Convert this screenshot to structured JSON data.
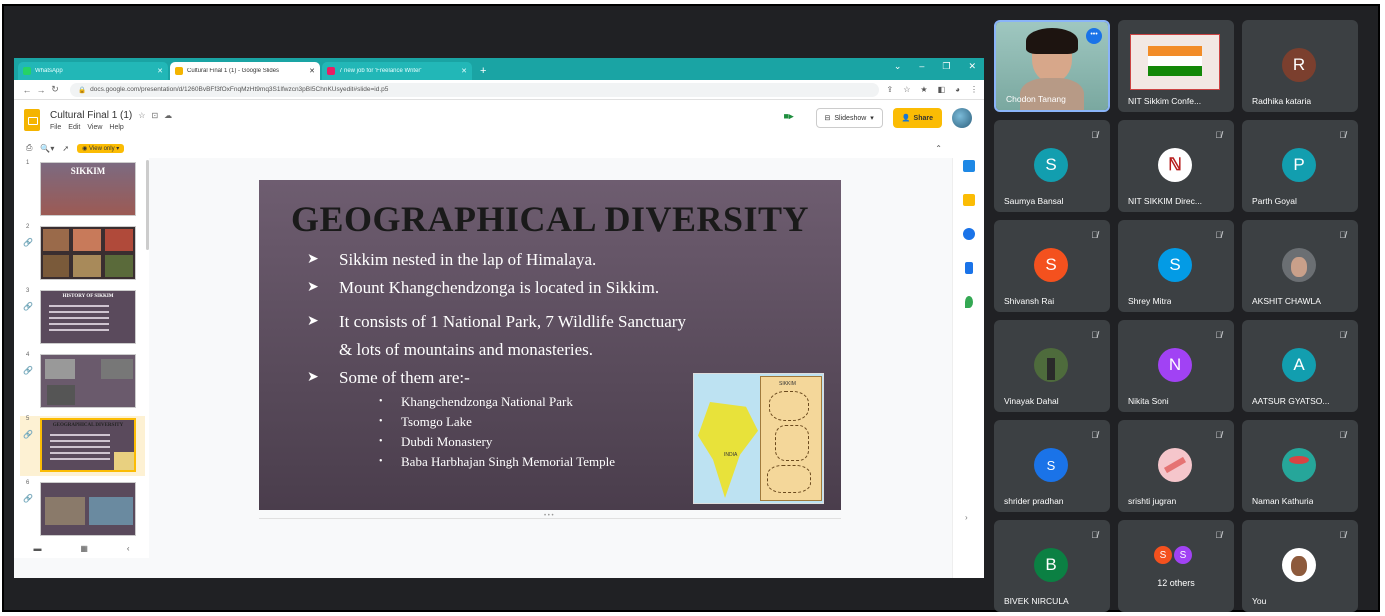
{
  "browser": {
    "tabs": [
      {
        "title": "WhatsApp",
        "color": "#25d366",
        "active": false
      },
      {
        "title": "Cultural Final 1 (1) - Google Slides",
        "color": "#f4b400",
        "active": true
      },
      {
        "title": "7 new job for 'Freelance Writer'",
        "color": "#e91e63",
        "active": false
      }
    ],
    "new_tab": "+",
    "url": "docs.google.com/presentation/d/1260BvBFf3fOxFnqMzHt9mq3S1lfwzcn3pBI5ChnKUsyedit#slide=id.p5"
  },
  "docs": {
    "title": "Cultural Final 1 (1)",
    "menu": [
      "File",
      "Edit",
      "View",
      "Help"
    ],
    "slideshow_label": "Slideshow",
    "share_label": "Share",
    "view_only_label": "View only"
  },
  "filmstrip": {
    "thumbs": [
      {
        "num": "1",
        "title": "SIKKIM"
      },
      {
        "num": "2",
        "title": ""
      },
      {
        "num": "3",
        "title": "HISTORY OF SIKKIM"
      },
      {
        "num": "4",
        "title": ""
      },
      {
        "num": "5",
        "title": "GEOGRAPHICAL DIVERSITY"
      },
      {
        "num": "6",
        "title": ""
      }
    ]
  },
  "slide": {
    "title": "GEOGRAPHICAL DIVERSITY",
    "bullets": [
      "Sikkim nested in the lap of Himalaya.",
      "Mount Khangchendzonga is located in Sikkim.",
      "It consists of 1 National Park, 7 Wildlife Sanctuary",
      "& lots of mountains and monasteries.",
      "Some of them are:-"
    ],
    "sub_bullets": [
      "Khangchendzonga National Park",
      "Tsomgo Lake",
      "Dubdi Monastery",
      "Baba Harbhajan Singh Memorial Temple"
    ],
    "map_labels": {
      "india": "INDIA",
      "sikkim": "SIKKIM"
    }
  },
  "participants": [
    {
      "name": "Chodon Tanang",
      "type": "video",
      "speaking": true
    },
    {
      "name": "NIT Sikkim Confe...",
      "type": "screen"
    },
    {
      "name": "Radhika kataria",
      "initial": "R",
      "color": "#7b3f2e"
    },
    {
      "name": "Saumya Bansal",
      "initial": "S",
      "color": "#129eaf",
      "muted": true
    },
    {
      "name": "NIT SIKKIM Direc...",
      "type": "logo",
      "muted": true
    },
    {
      "name": "Parth Goyal",
      "initial": "P",
      "color": "#129eaf",
      "muted": true
    },
    {
      "name": "Shivansh Rai",
      "initial": "S",
      "color": "#f4511e",
      "muted": true
    },
    {
      "name": "Shrey Mitra",
      "initial": "S",
      "color": "#039be5",
      "muted": true
    },
    {
      "name": "AKSHIT CHAWLA",
      "type": "photo",
      "muted": true
    },
    {
      "name": "Vinayak Dahal",
      "type": "photo",
      "muted": true
    },
    {
      "name": "Nikita Soni",
      "initial": "N",
      "color": "#a142f4",
      "muted": true
    },
    {
      "name": "AATSUR GYATSO...",
      "initial": "A",
      "color": "#129eaf",
      "muted": true
    },
    {
      "name": "shrider pradhan",
      "initial": "S",
      "color": "#1a73e8",
      "muted": true
    },
    {
      "name": "srishti jugran",
      "type": "photo",
      "muted": true
    },
    {
      "name": "Naman Kathuria",
      "type": "photo",
      "muted": true
    },
    {
      "name": "BIVEK NIRCULA",
      "initial": "B",
      "color": "#0b8043",
      "muted": true
    },
    {
      "name": "12 others",
      "type": "others",
      "initials": [
        "S",
        "S"
      ],
      "muted": true
    },
    {
      "name": "You",
      "type": "photo",
      "muted": true
    }
  ]
}
